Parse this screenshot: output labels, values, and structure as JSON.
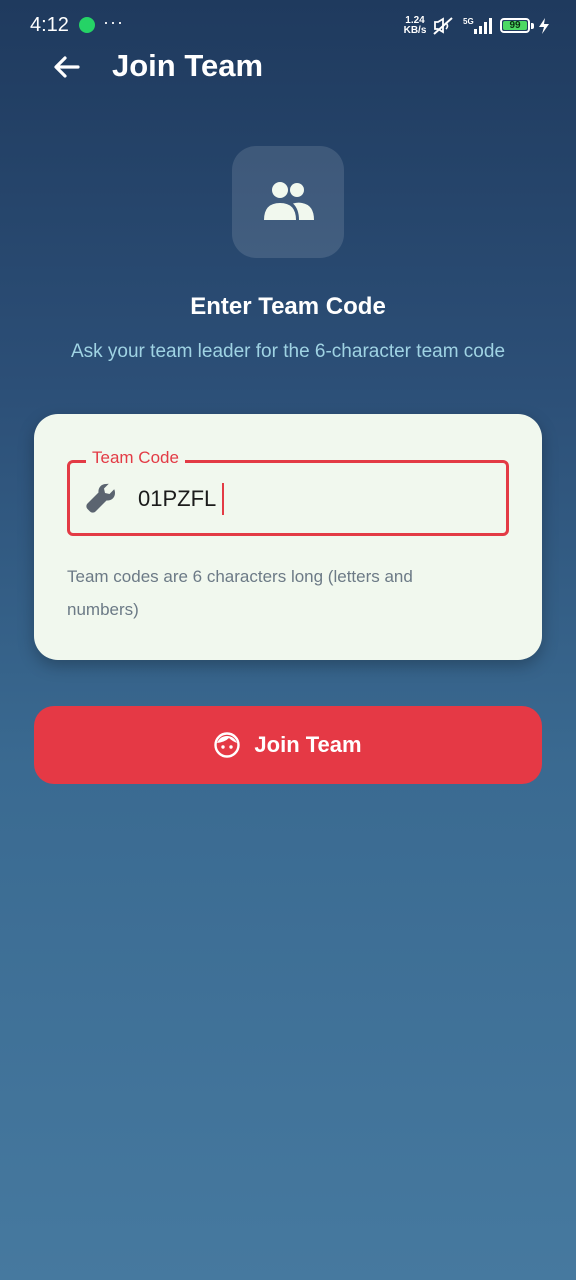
{
  "status_bar": {
    "time": "4:12",
    "more": "···",
    "speed_value": "1.24",
    "speed_unit": "KB/s",
    "network": "5G",
    "battery": "99",
    "icons": [
      "whatsapp-icon",
      "mute-icon",
      "signal-icon",
      "battery-icon",
      "charging-icon"
    ]
  },
  "header": {
    "back_icon": "arrow-left-icon",
    "title": "Join Team"
  },
  "intro": {
    "icon": "group-icon",
    "title": "Enter Team Code",
    "subtitle": "Ask your team leader for the 6-character team code"
  },
  "form": {
    "field_label": "Team Code",
    "field_icon": "wrench-icon",
    "field_value": "01PZFL",
    "helper_text": "Team codes are 6 characters long (letters and numbers)"
  },
  "actions": {
    "join_icon": "face-icon",
    "join_label": "Join Team"
  },
  "colors": {
    "accent": "#e53945",
    "card_background": "#f1f8ee",
    "subtitle": "#9fd3e3",
    "background_top": "#1f3a5e",
    "background_bottom": "#46799f"
  }
}
